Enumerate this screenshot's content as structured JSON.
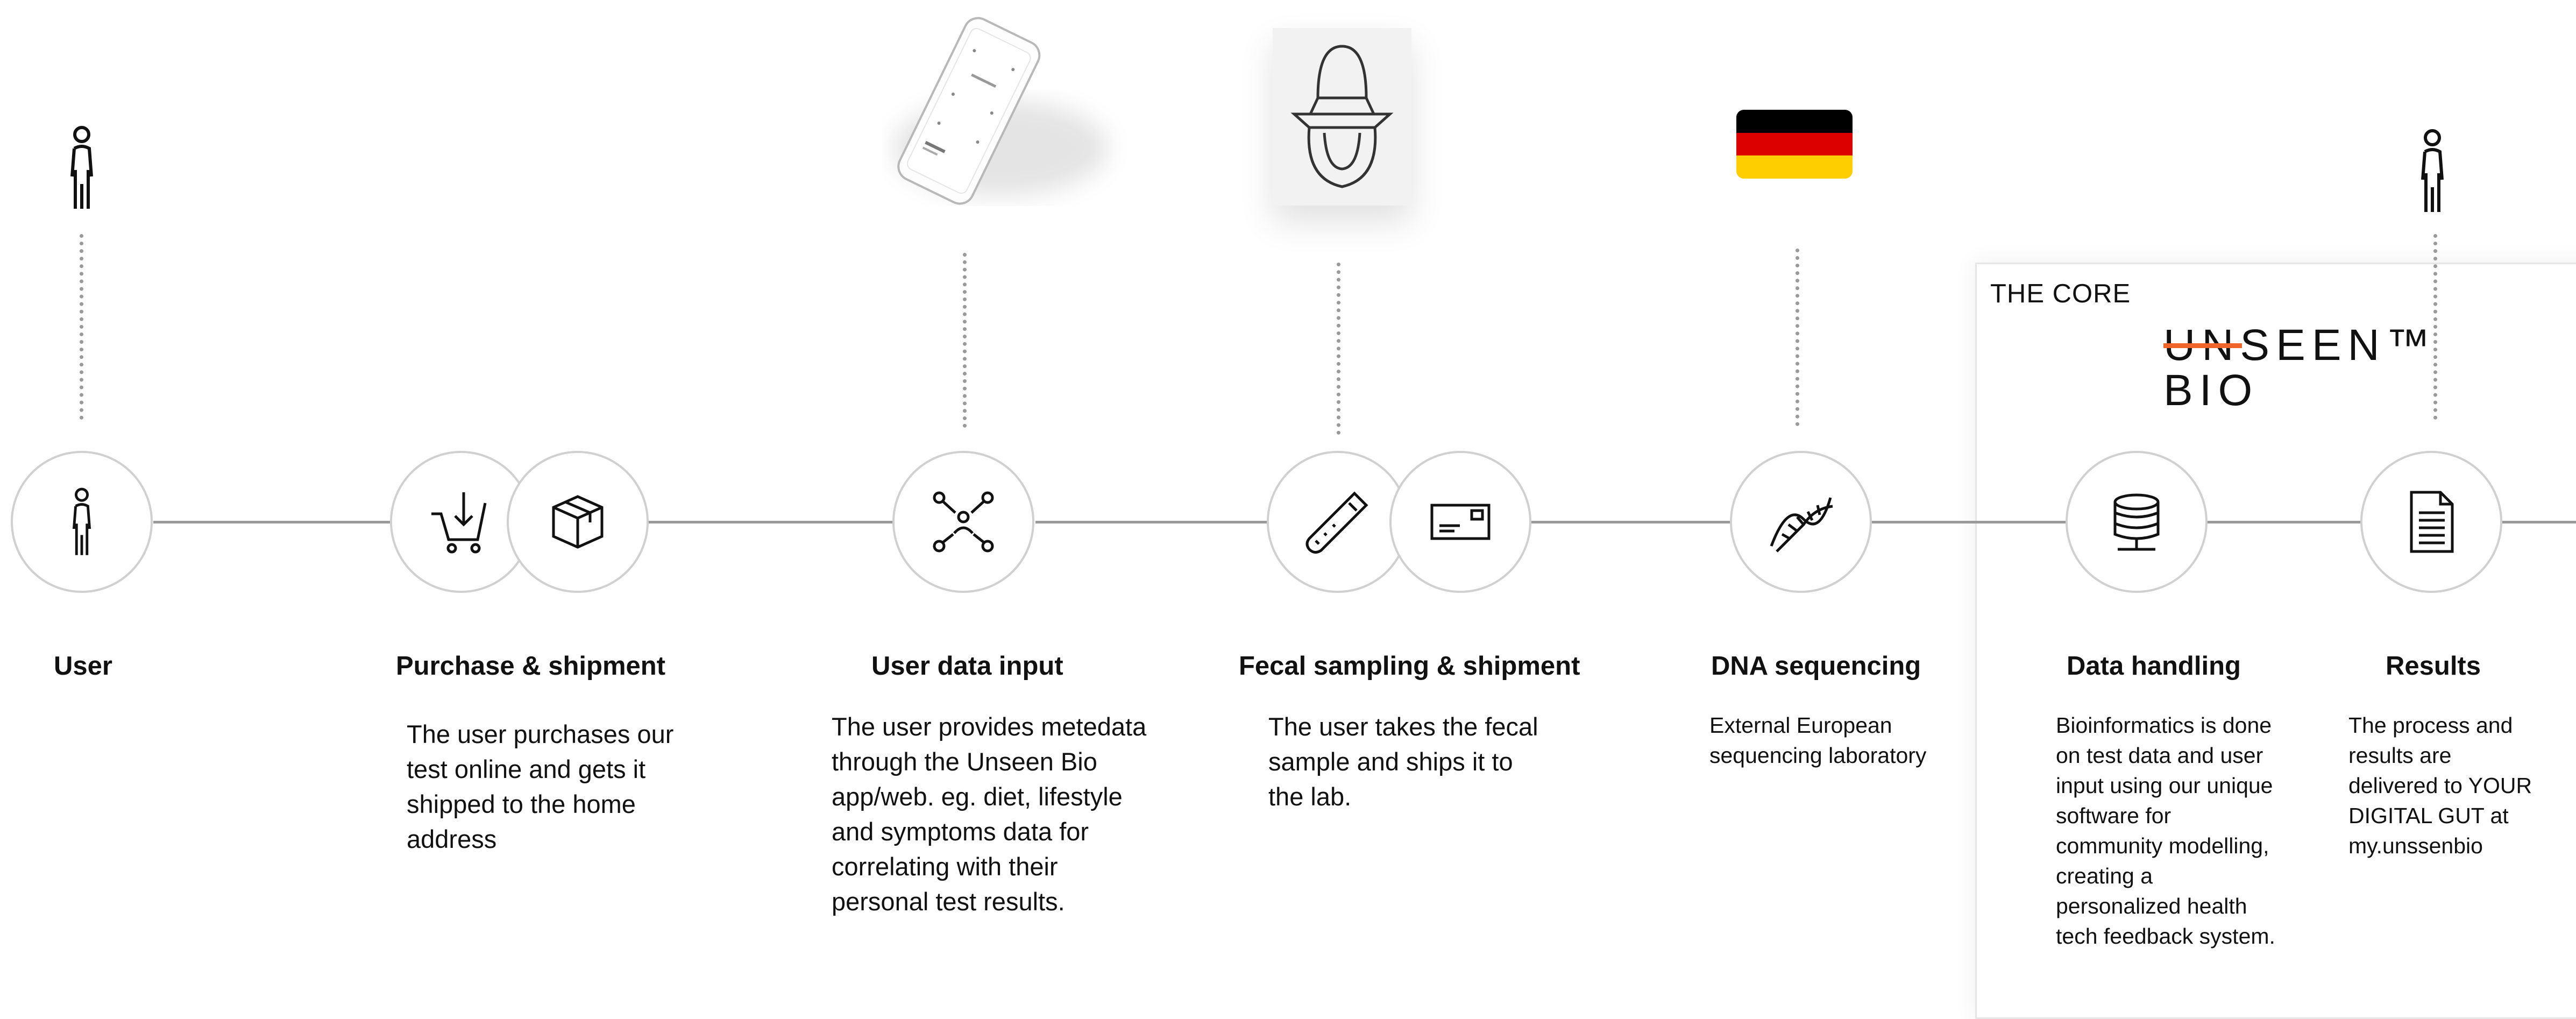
{
  "core": {
    "label": "THE CORE",
    "logo_line1": "UNSEEN™",
    "logo_line2": "BIO",
    "logo_accent": "#f0642a"
  },
  "flag_colors": [
    "#000000",
    "#dd0000",
    "#ffce00"
  ],
  "steps": [
    {
      "title": "User",
      "description": "",
      "icons": [
        "person-icon"
      ]
    },
    {
      "title": "Purchase & shipment",
      "description": "The user purchases our\ntest online and gets it\nshipped to the home\naddress",
      "icons": [
        "cart-download-icon",
        "package-box-icon"
      ]
    },
    {
      "title": "User data input",
      "description": "The user provides metedata\nthrough the Unseen Bio\napp/web. eg. diet, lifestyle\nand symptoms data for\ncorrelating with their\npersonal  test results.",
      "icons": [
        "network-user-icon"
      ]
    },
    {
      "title": "Fecal sampling & shipment",
      "description": "The user takes the fecal\nsample and ships it to\nthe lab.",
      "icons": [
        "sample-tube-icon",
        "envelope-icon"
      ]
    },
    {
      "title": "DNA sequencing",
      "description": "External European\nsequencing laboratory",
      "icons": [
        "dna-icon"
      ]
    },
    {
      "title": "Data handling",
      "description": "Bioinformatics is done\non test data and user\ninput using our unique\nsoftware for\ncommunity modelling,\ncreating a\npersonalized health\ntech feedback system.",
      "icons": [
        "database-icon"
      ]
    },
    {
      "title": "Results",
      "description": "The process and\nresults are\ndelivered to YOUR\nDIGITAL GUT at\nmy.unssenbio",
      "icons": [
        "document-icon"
      ]
    }
  ]
}
